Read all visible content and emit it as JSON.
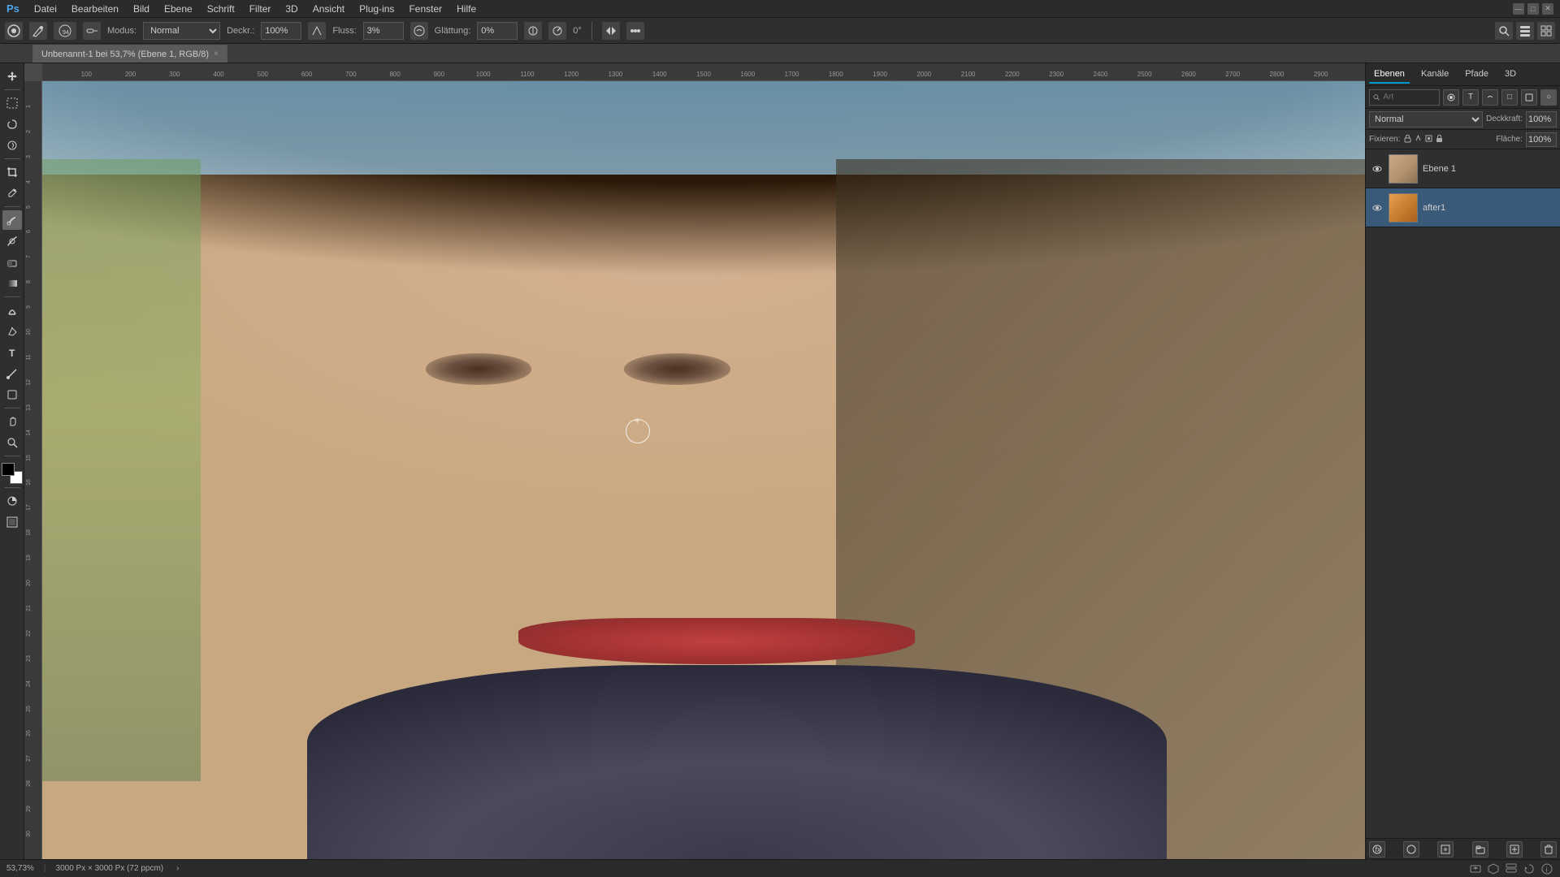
{
  "app": {
    "title": "Adobe Photoshop",
    "window_controls": {
      "minimize": "—",
      "maximize": "□",
      "close": "✕"
    }
  },
  "menubar": {
    "items": [
      "Datei",
      "Bearbeiten",
      "Bild",
      "Ebene",
      "Schrift",
      "Filter",
      "3D",
      "Ansicht",
      "Plug-ins",
      "Fenster",
      "Hilfe"
    ]
  },
  "options_bar": {
    "tool_icon": "⊙",
    "mode_label": "Modus:",
    "mode_value": "Normal",
    "coverage_label": "Deckr.:",
    "coverage_value": "100%",
    "flow_label": "Fluss:",
    "flow_value": "3%",
    "smoothing_label": "Glättung:",
    "smoothing_value": "0%"
  },
  "tab": {
    "label": "Unbenannt-1 bei 53,7% (Ebene 1, RGB/8)",
    "close": "×",
    "active": true
  },
  "canvas": {
    "zoom": "53,73%",
    "document_size": "3000 Px × 3000 Px (72 ppcm)"
  },
  "ruler": {
    "top_marks": [
      "100",
      "200",
      "300",
      "400",
      "500",
      "600",
      "700",
      "800",
      "900",
      "1000",
      "1100",
      "1200",
      "1300",
      "1400",
      "1500",
      "1600",
      "1700",
      "1800",
      "1900",
      "2000",
      "2100",
      "2200",
      "2300",
      "2400",
      "2500",
      "2600",
      "2700",
      "2800",
      "2900"
    ],
    "left_marks": [
      "1",
      "2",
      "3",
      "4",
      "5",
      "6",
      "7",
      "8",
      "9",
      "10",
      "11",
      "12",
      "13",
      "14",
      "15",
      "16",
      "17",
      "18",
      "19",
      "20",
      "21",
      "22",
      "23",
      "24",
      "25",
      "26",
      "27",
      "28",
      "29",
      "30"
    ]
  },
  "panels": {
    "tabs": [
      {
        "label": "Ebenen",
        "active": true
      },
      {
        "label": "Kanäle",
        "active": false
      },
      {
        "label": "Pfade",
        "active": false
      },
      {
        "label": "3D",
        "active": false
      }
    ]
  },
  "layers_panel": {
    "search_placeholder": "Art",
    "mode_dropdown": "Normal",
    "opacity_label": "Deckkraft:",
    "opacity_value": "100%",
    "fill_label": "Fläche:",
    "fill_value": "100%",
    "fixieren_label": "Fixieren:",
    "layers": [
      {
        "name": "Ebene 1",
        "visible": true,
        "selected": false,
        "thumb_type": "face"
      },
      {
        "name": "after1",
        "visible": true,
        "selected": true,
        "thumb_type": "orange"
      }
    ],
    "bottom_buttons": [
      "fx",
      "○",
      "□",
      "⊞",
      "🗑"
    ]
  },
  "status_bar": {
    "zoom": "53,73%",
    "doc_info": "3000 Px × 3000 Px (72 ppcm)",
    "separator": "›"
  }
}
